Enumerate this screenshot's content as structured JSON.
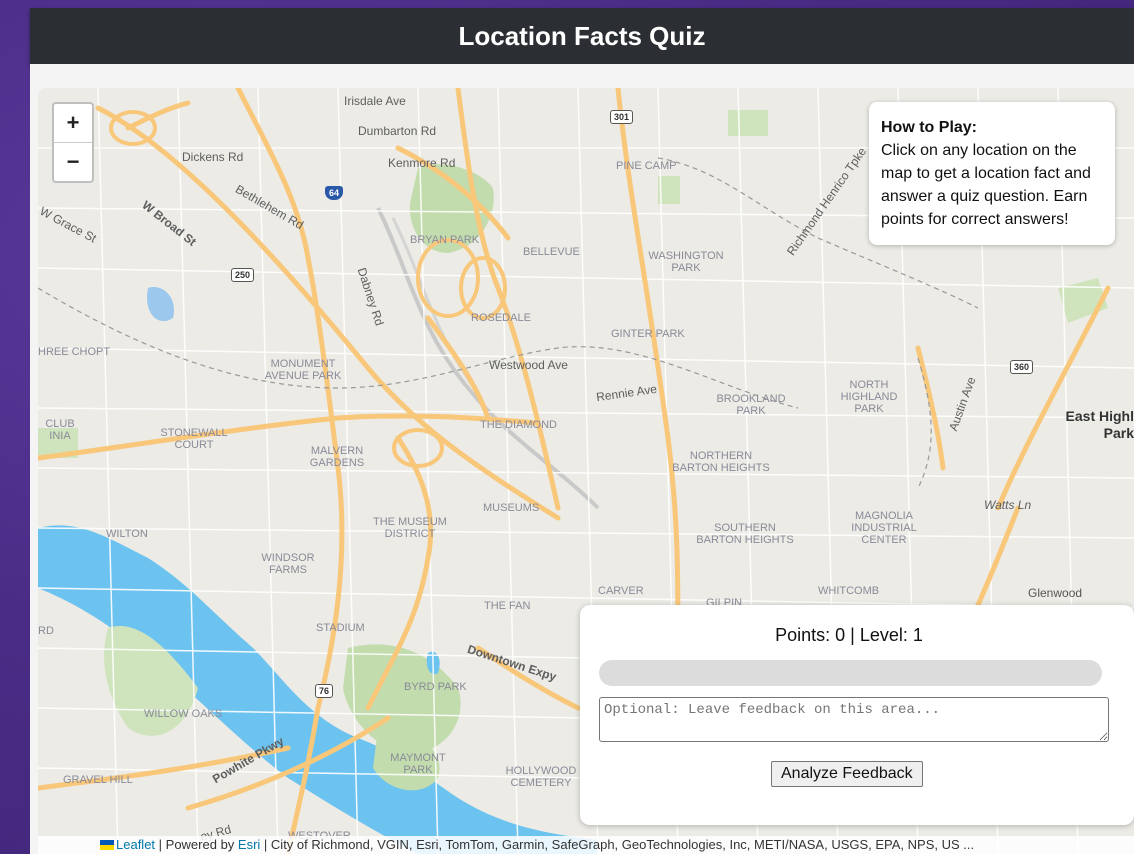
{
  "header": {
    "title": "Location Facts Quiz"
  },
  "map": {
    "zoom_in": "+",
    "zoom_out": "−",
    "labels": {
      "irisdale": "Irisdale Ave",
      "dumbarton": "Dumbarton Rd",
      "dickens": "Dickens Rd",
      "kenmore": "Kenmore Rd",
      "wbroad": "W Broad St",
      "bethlehem": "Bethlehem Rd",
      "wgrace": "W Grace St",
      "bryan_park": "BRYAN PARK",
      "bellevue": "BELLEVUE",
      "washington_park": "WASHINGTON PARK",
      "pine_camp": "PINE CAMP",
      "richmond_henrico": "Richmond Henrico Tpke",
      "dabney": "Dabney Rd",
      "rosedale": "ROSEDALE",
      "ginter_park": "GINTER PARK",
      "three_chopt": "HREE CHOPT",
      "monument": "MONUMENT AVENUE PARK",
      "westwood": "Westwood Ave",
      "rennie": "Rennie Ave",
      "brookland": "BROOKLAND PARK",
      "north_highland": "NORTH HIGHLAND PARK",
      "austin": "Austin Ave",
      "east_highland": "East Highl Park",
      "club": "CLUB INIA",
      "stonewall": "STONEWALL COURT",
      "malvern": "MALVERN GARDENS",
      "diamond": "THE DIAMOND",
      "north_barton": "NORTHERN BARTON HEIGHTS",
      "museums": "MUSEUMS",
      "museum_district": "THE MUSEUM DISTRICT",
      "southern_barton": "SOUTHERN BARTON HEIGHTS",
      "magnolia": "MAGNOLIA INDUSTRIAL CENTER",
      "watts": "Watts Ln",
      "wilton": "WILTON",
      "windsor": "WINDSOR FARMS",
      "carver": "CARVER",
      "gilpin": "GILPIN",
      "whitcomb": "WHITCOMB",
      "glenwood": "Glenwood",
      "the_fan": "THE FAN",
      "rd": "RD",
      "stadium": "STADIUM",
      "downtown": "Downtown Expy",
      "byrd": "BYRD PARK",
      "willow": "WILLOW OAKS",
      "powhite": "Powhite Pkwy",
      "maymont": "MAYMONT PARK",
      "hollywood": "HOLLYWOOD CEMETERY",
      "gravel": "GRAVEL HILL",
      "westover": "WESTOVER",
      "ey_rd": "ey Rd"
    },
    "shields": {
      "i64": "64",
      "us301": "301",
      "us250": "250",
      "r360": "360",
      "r76": "76"
    }
  },
  "how_to": {
    "title": "How to Play:",
    "body": "Click on any location on the map to get a location fact and answer a quiz question. Earn points for correct answers!"
  },
  "quiz": {
    "points_text": "Points: 0 | Level: 1",
    "progress_percent": 0,
    "feedback_placeholder": "Optional: Leave feedback on this area...",
    "button_label": "Analyze Feedback"
  },
  "attribution": {
    "leaflet": "Leaflet",
    "powered": " | Powered by ",
    "esri": "Esri",
    "rest": " | City of Richmond, VGIN, Esri, TomTom, Garmin, SafeGraph, GeoTechnologies, Inc, METI/NASA, USGS, EPA, NPS, US ..."
  }
}
